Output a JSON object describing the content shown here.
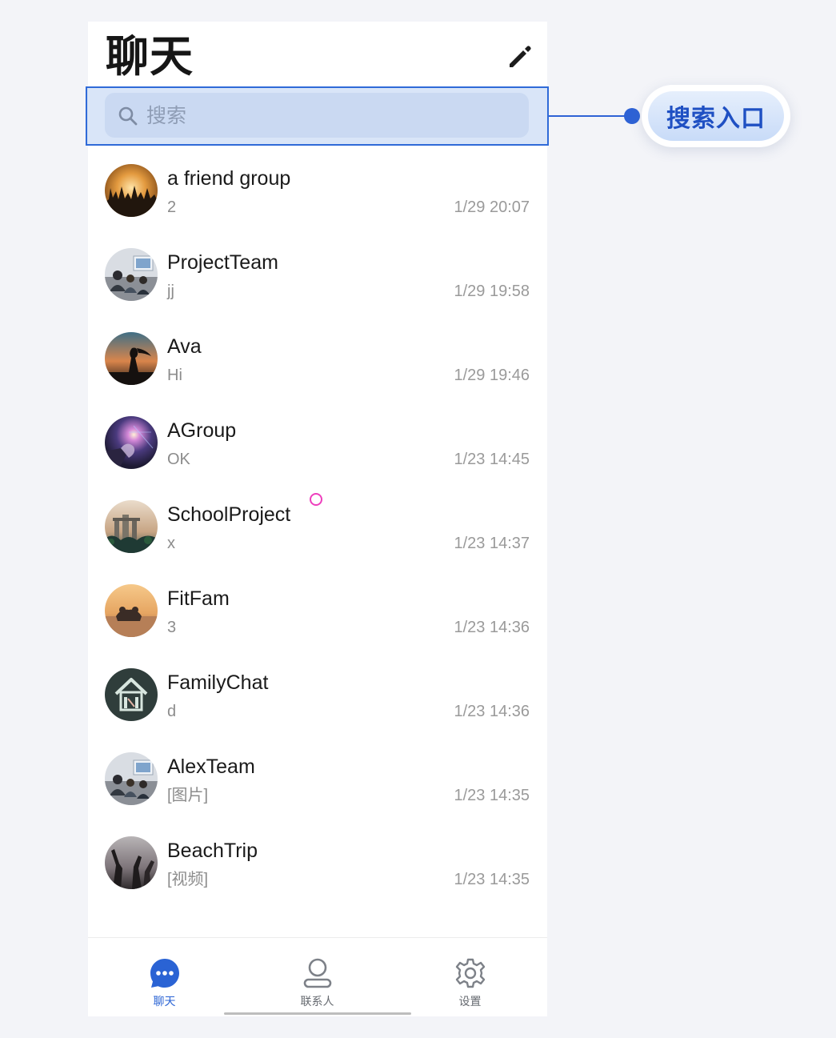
{
  "header": {
    "title": "聊天",
    "compose_icon": "pencil-icon"
  },
  "search": {
    "placeholder": "搜索",
    "icon": "search-icon"
  },
  "annotation": {
    "label": "搜索入口",
    "color": "#2e62d5"
  },
  "chats": [
    {
      "name": "a friend group",
      "preview": "2",
      "time": "1/29 20:07"
    },
    {
      "name": "ProjectTeam",
      "preview": "jj",
      "time": "1/29 19:58"
    },
    {
      "name": "Ava",
      "preview": "Hi",
      "time": "1/29 19:46"
    },
    {
      "name": "AGroup",
      "preview": "OK",
      "time": "1/23 14:45"
    },
    {
      "name": "SchoolProject",
      "preview": "x",
      "time": "1/23 14:37"
    },
    {
      "name": "FitFam",
      "preview": "3",
      "time": "1/23 14:36"
    },
    {
      "name": "FamilyChat",
      "preview": "d",
      "time": "1/23 14:36"
    },
    {
      "name": "AlexTeam",
      "preview": "[图片]",
      "time": "1/23 14:35"
    },
    {
      "name": "BeachTrip",
      "preview": "[视频]",
      "time": "1/23 14:35"
    }
  ],
  "tabs": [
    {
      "label": "聊天",
      "icon": "chat-bubble-icon",
      "active": true
    },
    {
      "label": "联系人",
      "icon": "person-icon",
      "active": false
    },
    {
      "label": "设置",
      "icon": "gear-icon",
      "active": false
    }
  ],
  "colors": {
    "accent": "#2a63d4",
    "search_bg": "#e4eaf5",
    "touch_marker": "#ee3fbd"
  }
}
